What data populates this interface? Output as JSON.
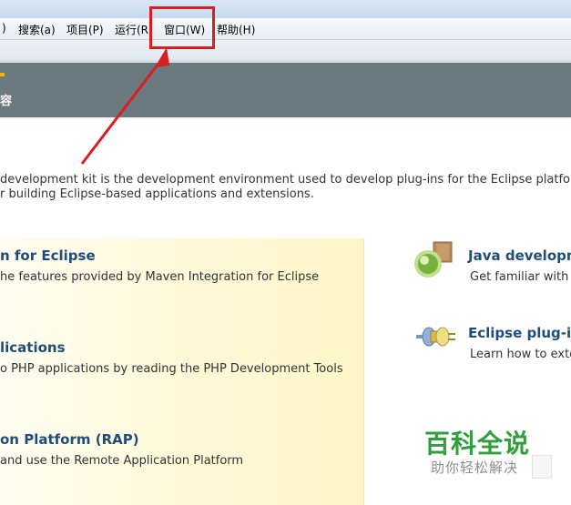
{
  "menu": {
    "items": [
      "搜索(a)",
      "项目(P)",
      "运行(R",
      "窗口(W)",
      "帮助(H)"
    ],
    "left_fragment": ")"
  },
  "header": {
    "label": "容"
  },
  "intro": {
    "line1": "development kit is the development environment used to develop plug-ins for the Eclipse platform. I",
    "line2": "r building Eclipse-based applications and extensions."
  },
  "left_sections": [
    {
      "title": "n for Eclipse",
      "desc": "he features provided by Maven Integration for Eclipse"
    },
    {
      "title": "lications",
      "desc": "o PHP applications by reading the PHP Development Tools"
    },
    {
      "title": "on Platform (RAP)",
      "desc": "and use the Remote Application Platform"
    }
  ],
  "right_sections": [
    {
      "title": "Java developm",
      "desc": "Get familiar with c",
      "icon": "java-development-icon"
    },
    {
      "title": "Eclipse plug-in",
      "desc": "Learn how to exte",
      "icon": "plug-in-icon"
    }
  ],
  "watermark": {
    "main": "百科全说",
    "sub": "助你轻松解决"
  },
  "colors": {
    "accent_red": "#d81e1e",
    "header": "#6c7a80",
    "panel": "#fff6c8",
    "title_blue": "#1f4d7a",
    "watermark_green": "#2f9e3b"
  }
}
